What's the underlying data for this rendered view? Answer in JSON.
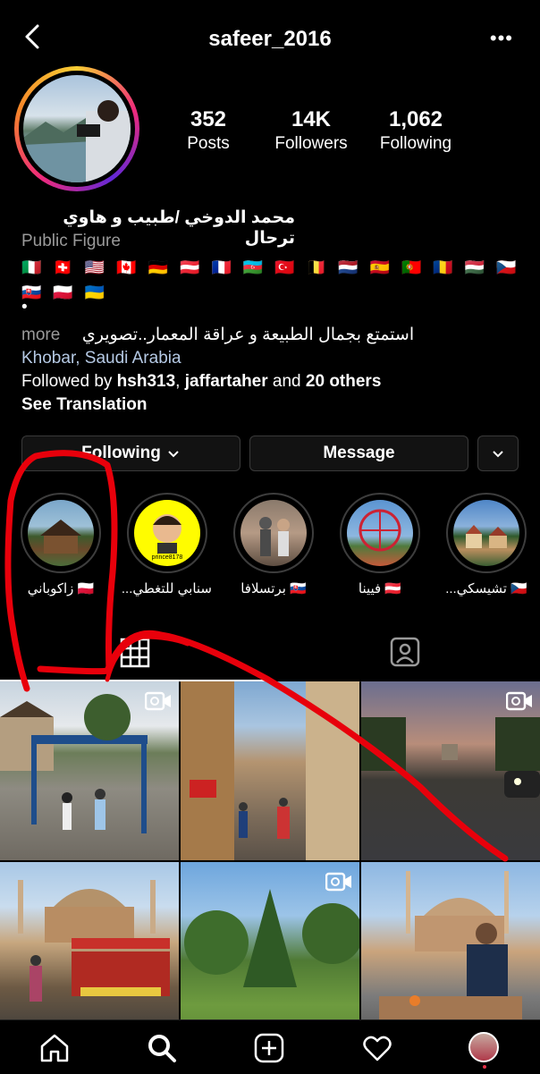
{
  "header": {
    "username": "safeer_2016"
  },
  "stats": [
    {
      "value": "352",
      "label": "Posts"
    },
    {
      "value": "14K",
      "label": "Followers"
    },
    {
      "value": "1,062",
      "label": "Following"
    }
  ],
  "bio": {
    "name": "محمد الدوخي /طبيب و هاوي ترحال",
    "category": "Public Figure",
    "flags": "🇮🇹 🇨🇭 🇺🇸 🇨🇦 🇩🇪 🇦🇹 🇫🇷 🇦🇿 🇹🇷 🇧🇪 🇳🇱 🇪🇸 🇵🇹 🇷🇴 🇭🇺 🇨🇿 🇸🇰 🇵🇱 🇺🇦",
    "dot": "•",
    "description": "استمتع بجمال الطبيعة و عراقة المعمار..تصويري",
    "more": "more",
    "location_city": "Khobar",
    "location_sep": ", ",
    "location_country": "Saudi Arabia",
    "followed_prefix": "Followed by ",
    "followed_user1": "hsh313",
    "followed_comma": ", ",
    "followed_user2": "jaffartaher",
    "followed_and": " and ",
    "followed_others": "20 others",
    "see_translation": "See Translation"
  },
  "buttons": {
    "following": "Following",
    "message": "Message"
  },
  "highlights": [
    {
      "label": "🇵🇱 زاكوباني"
    },
    {
      "label": "سنابي للتغطي...",
      "sub": "prince8178"
    },
    {
      "label": "🇸🇰 برتسلافا"
    },
    {
      "label": "🇦🇹 فيينا"
    },
    {
      "label": "🇨🇿 تشيسكي..."
    }
  ],
  "grid": [
    {
      "scene": "town square with mist arch",
      "video": true
    },
    {
      "scene": "old town street",
      "video": false
    },
    {
      "scene": "boulevard at dusk with cars",
      "video": true
    },
    {
      "scene": "mosque with corn vendor cart",
      "video": false
    },
    {
      "scene": "park with green trees",
      "video": true
    },
    {
      "scene": "man seated before mosque",
      "video": false
    }
  ],
  "colors": {
    "accent_link": "#b5c9e4",
    "muted": "#9a9a9a",
    "annotation": "#e8000b",
    "background": "#000000"
  },
  "icons": {
    "back": "chevron-left-icon",
    "more": "ellipsis-icon",
    "grid": "grid-icon",
    "tagged": "tagged-icon",
    "home": "home-icon",
    "search": "search-icon",
    "add": "add-icon",
    "heart": "heart-icon"
  }
}
